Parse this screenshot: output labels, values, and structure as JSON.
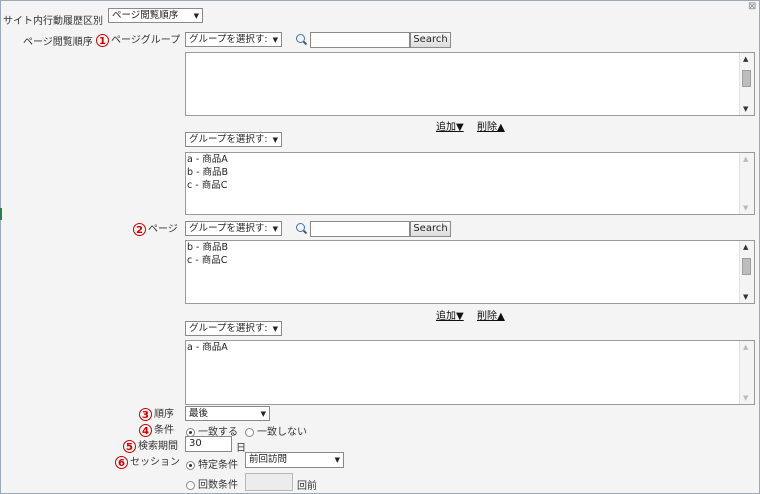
{
  "close_glyph": "⊠",
  "header": {
    "label": "サイト内行動履歴区別",
    "select_value": "ページ閲覧順序"
  },
  "page_group": {
    "section_label": "ページ閲覧順序",
    "marker": "1",
    "label": "ページグループ",
    "select_value": "グループを選択す:",
    "search_value": "",
    "search_button": "Search",
    "available_items": [],
    "add_link": "追加▼",
    "remove_link": "削除▲",
    "selected_select_value": "グループを選択す:",
    "selected_items": [
      "a - 商品A",
      "b - 商品B",
      "c - 商品C"
    ]
  },
  "page": {
    "marker": "2",
    "label": "ページ",
    "select_value": "グループを選択す:",
    "search_value": "",
    "search_button": "Search",
    "available_items": [
      "b - 商品B",
      "c - 商品C"
    ],
    "add_link": "追加▼",
    "remove_link": "削除▲",
    "selected_select_value": "グループを選択す:",
    "selected_items": [
      "a - 商品A"
    ]
  },
  "order": {
    "marker": "3",
    "label": "順序",
    "select_value": "最後"
  },
  "condition": {
    "marker": "4",
    "label": "条件",
    "options": [
      "一致する",
      "一致しない"
    ],
    "selected": "一致する"
  },
  "period": {
    "marker": "5",
    "label": "検索期間",
    "value": "30",
    "unit": "日"
  },
  "session": {
    "marker": "6",
    "label": "セッション",
    "option_specific": "特定条件",
    "specific_select_value": "前回訪問",
    "option_count": "回数条件",
    "count_value": "",
    "count_unit": "回前",
    "selected": "特定条件"
  }
}
